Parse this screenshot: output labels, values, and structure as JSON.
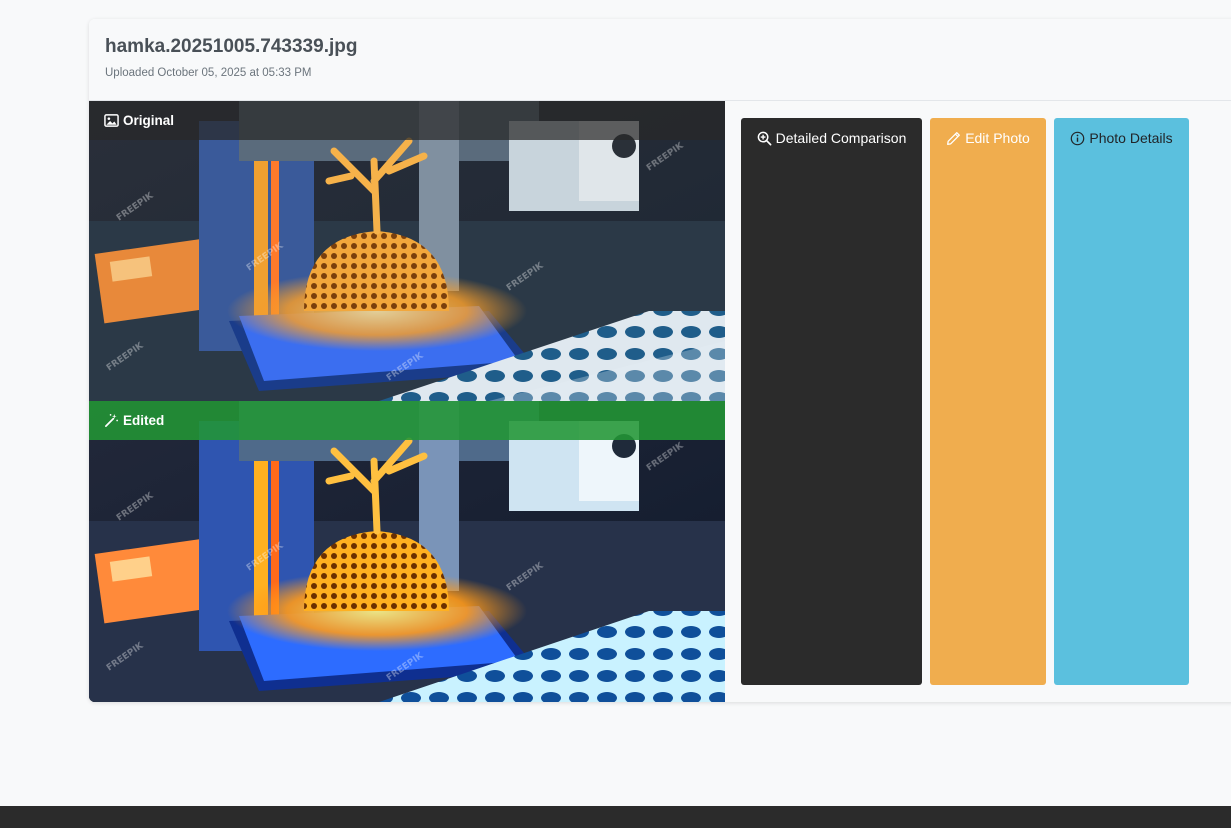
{
  "photo": {
    "filename": "hamka.20251005.743339.jpg",
    "uploaded": "Uploaded October 05, 2025 at 05:33 PM"
  },
  "panels": {
    "original": {
      "label": "Original",
      "icon": "image-icon"
    },
    "edited": {
      "label": "Edited",
      "icon": "magic-wand-icon"
    }
  },
  "actions": {
    "compare": {
      "label": "Detailed Comparison",
      "icon": "zoom-in-icon"
    },
    "edit": {
      "label": "Edit Photo",
      "icon": "pencil-icon"
    },
    "details": {
      "label": "Photo Details",
      "icon": "info-circle-icon"
    }
  },
  "watermark": "FREEPIK",
  "colors": {
    "compare_button": "#2b2b2b",
    "edit_button": "#f0ad4e",
    "details_button": "#5bc0de",
    "edited_label": "#229634",
    "footer": "#2b2b2b"
  }
}
